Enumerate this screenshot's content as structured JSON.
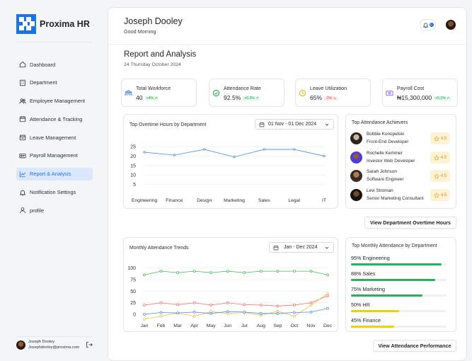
{
  "app": {
    "name": "Proxima HR"
  },
  "sidebar": {
    "items": [
      {
        "label": "Dashboard",
        "icon": "home-icon"
      },
      {
        "label": "Department",
        "icon": "building-icon"
      },
      {
        "label": "Employee Management",
        "icon": "users-icon"
      },
      {
        "label": "Attendance & Tracking",
        "icon": "calendar-icon"
      },
      {
        "label": "Leave Management",
        "icon": "leave-calendar-icon"
      },
      {
        "label": "Payroll Management",
        "icon": "payroll-icon"
      },
      {
        "label": "Report & Analysis",
        "icon": "chart-icon",
        "active": true
      },
      {
        "label": "Notification Settings",
        "icon": "bell-icon"
      },
      {
        "label": "profile",
        "icon": "user-icon"
      }
    ],
    "user": {
      "name": "Joseph Dooley",
      "email": "Josephdooley@proxima.com"
    }
  },
  "header": {
    "name": "Joseph Dooley",
    "greeting": "Good Morning",
    "notification_count": "0"
  },
  "page": {
    "title": "Report and Analysis",
    "date": "24 Thursday October 2024"
  },
  "kpis": [
    {
      "label": "Total Workforce",
      "value": "40",
      "change": "+4%",
      "trend": "up",
      "icon": "team-icon",
      "color": "#1a73e8"
    },
    {
      "label": "Attendance Rate",
      "value": "92.5%",
      "change": "+0.3%",
      "trend": "up",
      "icon": "check-circle-icon",
      "color": "#22a04b"
    },
    {
      "label": "Leave Utilization",
      "value": "65%",
      "change": "-2%",
      "trend": "down",
      "icon": "clock-icon",
      "color": "#e6b800"
    },
    {
      "label": "Payroll Cost",
      "value": "₦15,300,000",
      "change": "+5.1%",
      "trend": "up",
      "icon": "wallet-icon",
      "color": "#8a5cf6"
    }
  ],
  "overtime": {
    "title": "Top Overtime Hours by Department",
    "date_range": "01 Nov - 01 Dec 2024",
    "button": "View Department Overtime Hours"
  },
  "achievers": {
    "title": "Top Attendance Achievers",
    "items": [
      {
        "name": "Bobbie Konopelski",
        "role": "Front-End Developer",
        "score": "4.5"
      },
      {
        "name": "Rochelle Kemmer",
        "role": "Investor Web Developer",
        "score": "4.5"
      },
      {
        "name": "Sarah Johnson",
        "role": "Software Engineer",
        "score": "4.5"
      },
      {
        "name": "Levi Stroman",
        "role": "Senior Marketing Consultant",
        "score": "4.5"
      }
    ]
  },
  "monthly": {
    "title": "Monthly Attendance Trends",
    "date_range": "Jan - Dec 2024",
    "button": "View Attendance Performance"
  },
  "dept_attendance": {
    "title": "Top Monthly Attendance by Department",
    "items": [
      {
        "label": "95% Engineering",
        "value": 95,
        "color": "#22b55a"
      },
      {
        "label": "88% Sales",
        "value": 88,
        "color": "#22b55a"
      },
      {
        "label": "75% Marketing",
        "value": 75,
        "color": "#22b55a"
      },
      {
        "label": "50% HR",
        "value": 50,
        "color": "#f2c91c"
      },
      {
        "label": "45% Finance",
        "value": 45,
        "color": "#f2c91c"
      }
    ]
  },
  "chart_data": [
    {
      "type": "line",
      "title": "Top Overtime Hours by Department",
      "categories": [
        "Engineering",
        "Finance",
        "Design",
        "Marketing",
        "Sales",
        "Legal",
        "IT"
      ],
      "series": [
        {
          "values": [
            22,
            20.5,
            23.5,
            19.5,
            23.5,
            23.5,
            20
          ],
          "color": "#4a90e2"
        }
      ],
      "yticks": [
        5,
        10,
        15,
        20,
        25
      ],
      "ylim": [
        0,
        28
      ],
      "grid": true
    },
    {
      "type": "line",
      "title": "Monthly Attendance Trends",
      "categories": [
        "Jan",
        "Feb",
        "Mar",
        "Apr",
        "May",
        "Jun",
        "Jul",
        "Aug",
        "Sep",
        "Oct",
        "Nov",
        "Dec"
      ],
      "series": [
        {
          "values": [
            85,
            93,
            90,
            93,
            90,
            93,
            90,
            93,
            93,
            93,
            93,
            85
          ],
          "color": "#3dbb5c"
        },
        {
          "values": [
            20,
            25,
            21,
            25,
            20,
            25,
            21,
            20,
            18,
            20,
            25,
            40
          ],
          "color": "#ef6f6c"
        },
        {
          "values": [
            -10,
            -4,
            3,
            -4,
            6,
            2,
            4,
            -2,
            7,
            -4,
            20,
            45
          ],
          "color": "#f5c242"
        },
        {
          "values": [
            0,
            4,
            3,
            5,
            2,
            6,
            5,
            2,
            2,
            4,
            5,
            13
          ],
          "color": "#4a90e2"
        }
      ],
      "yticks": [
        0,
        25,
        50,
        75,
        100
      ],
      "ylim": [
        -12,
        110
      ],
      "grid": true
    }
  ]
}
